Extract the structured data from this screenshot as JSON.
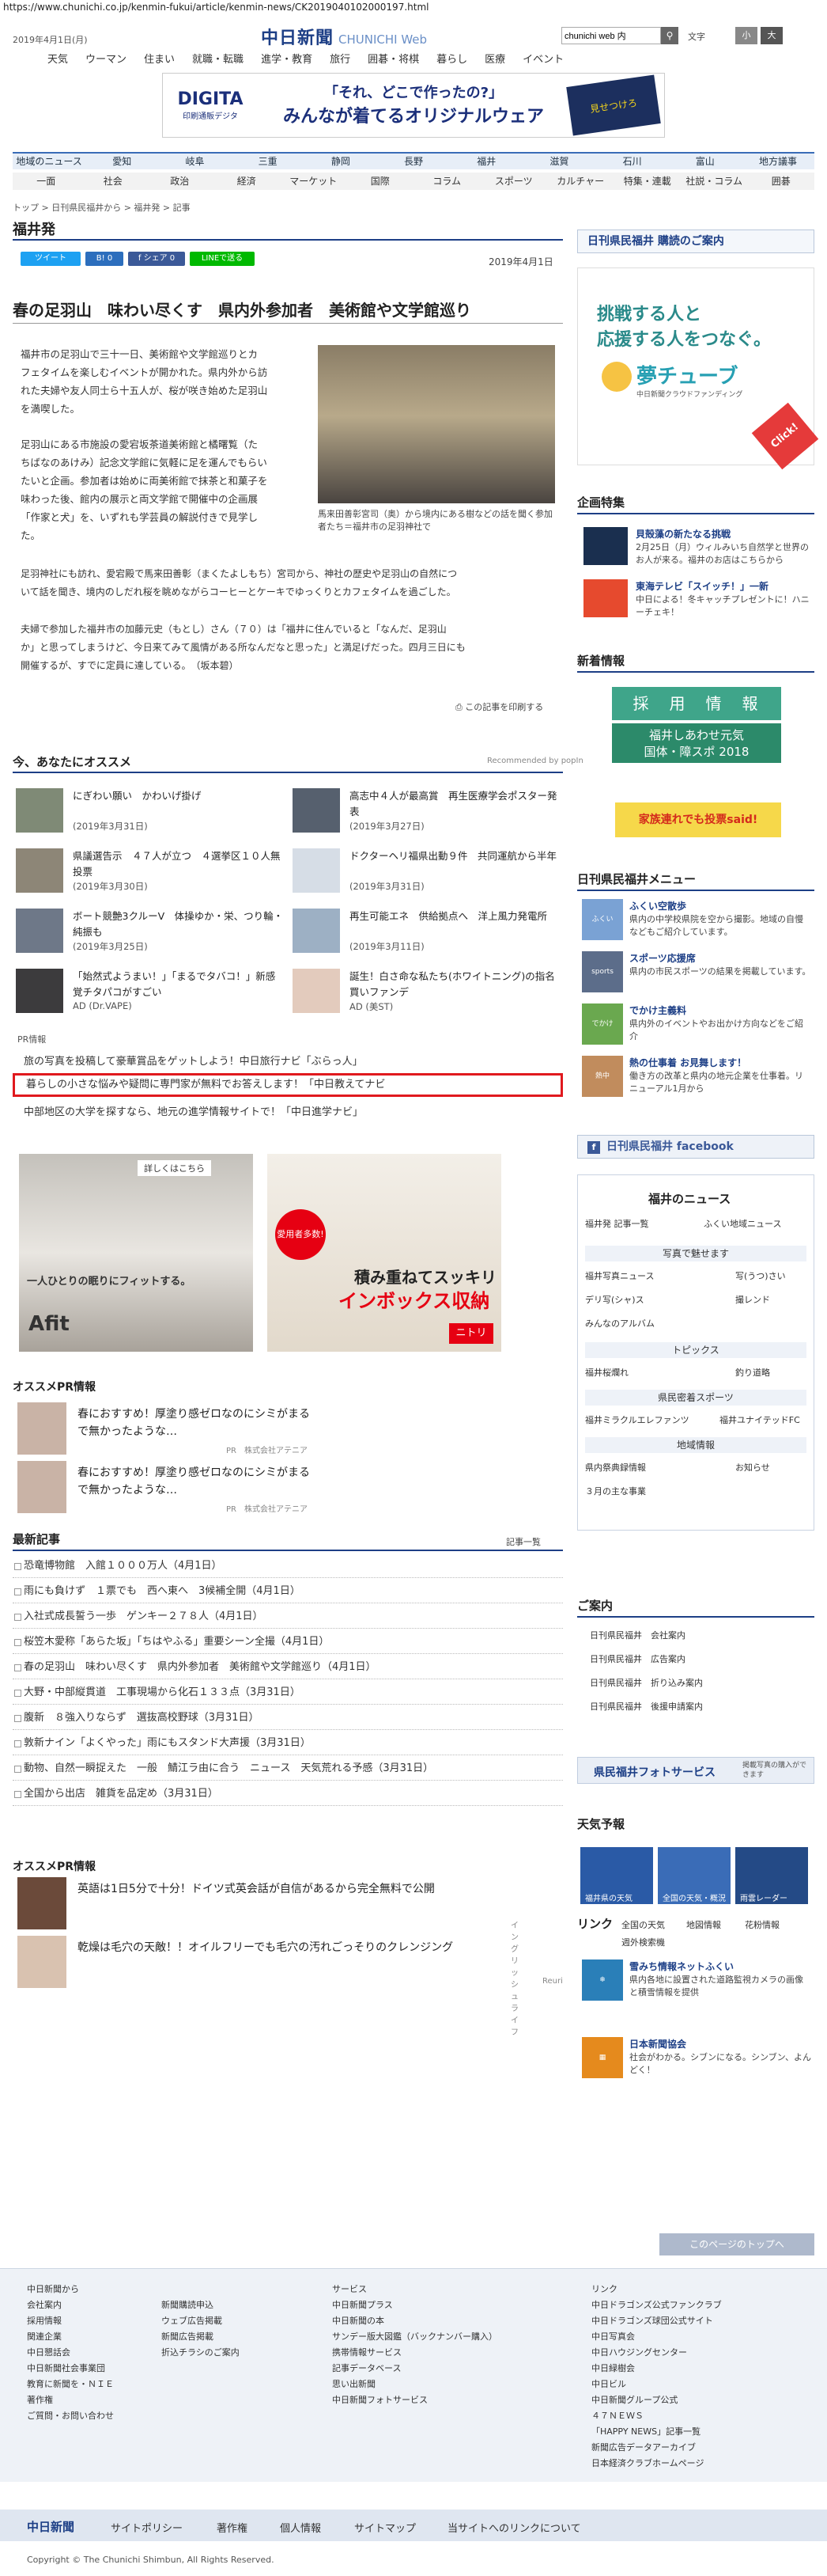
{
  "browser": {
    "url": "https://www.chunichi.co.jp/kenmin-fukui/article/kenmin-news/CK2019040102000197.html"
  },
  "header": {
    "date": "2019年4月1日(月)",
    "logo_main": "中日新聞",
    "logo_sub": "CHUNICHI Web",
    "search_value": "chunichi web 内",
    "font_label": "文字",
    "font_decrease": "小",
    "font_increase": "大",
    "nav": [
      "天気",
      "ウーマン",
      "住まい",
      "就職・転職",
      "進学・教育",
      "旅行",
      "囲碁・将棋",
      "暮らし",
      "医療",
      "イベント"
    ]
  },
  "banner": {
    "brand": "DIGITA",
    "brand_sub": "印刷通販デジタ",
    "line1": "「それ、どこで作ったの?」",
    "line2": "みんなが着てるオリジナルウェア",
    "shirt": "見せつけろ"
  },
  "region_nav": [
    "地域のニュース",
    "愛知",
    "岐阜",
    "三重",
    "静岡",
    "長野",
    "福井",
    "滋賀",
    "石川",
    "富山",
    "地方議事"
  ],
  "cat_nav": [
    "一面",
    "社会",
    "政治",
    "経済",
    "マーケット",
    "国際",
    "コラム",
    "スポーツ",
    "カルチャー",
    "特集・連載",
    "社説・コラム",
    "囲碁"
  ],
  "breadcrumb": "トップ > 日刊県民福井から > 福井発 > 記事",
  "section_title": "福井発",
  "share": {
    "tweet": "ツイート",
    "hatena": "B! 0",
    "facebook": "f シェア 0",
    "line": "LINEで送る"
  },
  "article": {
    "date": "2019年4月1日",
    "headline": "春の足羽山　味わい尽くす　県内外参加者　美術館や文学館巡り",
    "p1": [
      "福井市の足羽山で三十一日、美術館や文学館巡りとカ",
      "フェタイムを楽しむイベントが開かれた。県内外から訪",
      "れた夫婦や友人同士ら十五人が、桜が咲き始めた足羽山",
      "を満喫した。"
    ],
    "p2": [
      "足羽山にある市施設の愛宕坂茶道美術館と橘曙覧（た",
      "ちばなのあけみ）記念文学館に気軽に足を運んでもらい",
      "たいと企画。参加者は始めに両美術館で抹茶と和菓子を",
      "味わった後、館内の展示と両文学館で開催中の企画展",
      "「作家と犬」を、いずれも学芸員の解説付きで見学し",
      "た。"
    ],
    "p3": [
      "足羽神社にも訪れ、愛宕殿で馬来田善彰（まくたよしもち）宮司から、神社の歴史や足羽山の自然につ",
      "いて話を聞き、境内のしだれ桜を眺めながらコーヒーとケーキでゆっくりとカフェタイムを過ごした。"
    ],
    "p4": [
      "夫婦で参加した福井市の加藤元史（もとし）さん（７０）は「福井に住んでいると「なんだ、足羽山",
      "か」と思ってしまうけど、今日来てみて風情がある所なんだなと思った」と満足げだった。四月三日にも",
      "開催するが、すでに定員に達している。　（坂本碧）"
    ],
    "photo_caption": "馬来田善彰宮司（奥）から境内にある樹などの話を聞く参加者たち＝福井市の足羽神社で",
    "print_link": "この記事を印刷する"
  },
  "recommend": {
    "heading": "今、あなたにオススメ",
    "by": "Recommended by popIn",
    "items": [
      {
        "title": "にぎわい願い　かわいげ掛げ",
        "date": "(2019年3月31日)"
      },
      {
        "title": "高志中４人が最高賞　再生医療学会ポスター発表",
        "date": "(2019年3月27日)"
      },
      {
        "title": "県議選告示　４７人が立つ　４選挙区１０人無投票",
        "date": "(2019年3月30日)"
      },
      {
        "title": "ドクターヘリ福県出動９件　共同運航から半年",
        "date": "(2019年3月31日)"
      },
      {
        "title": "ボート競艶3クルーV　体操ゆか・栄、つり輪・純振も",
        "date": "(2019年3月25日)"
      },
      {
        "title": "再生可能エネ　供給拠点へ　洋上風力発電所",
        "date": "(2019年3月11日)"
      },
      {
        "title": "「始然式ようまい！」「まるでタバコ！」新感覚チタパコがすごい",
        "date": "AD (Dr.VAPE)"
      },
      {
        "title": "誕生！白さ命な私たち(ホワイトニング)の指名買いファンデ",
        "date": "AD (美ST)"
      }
    ]
  },
  "pr": {
    "label": "PR情報",
    "lines": [
      "旅の写真を投稿して豪華賞品をゲットしよう！中日旅行ナビ「ぶらっ人」",
      "暮らしの小さな悩みや疑問に専門家が無料でお答えします！「中日教えてナビ",
      "中部地区の大学を探すなら、地元の進学情報サイトで！「中日進学ナビ」"
    ]
  },
  "ads": {
    "left_top": "詳しくはこちら",
    "left_slogan": "一人ひとりの眠りにフィットする。",
    "left_brand": "Afit",
    "right_slogan": "積み重ねてスッキリ",
    "right_title": "インボックス収納",
    "right_brand": "ニトリ",
    "right_badge": "愛用者多数!"
  },
  "oso_pr": {
    "heading": "オススメPR情報",
    "items": [
      {
        "title": "春におすすめ！厚塗り感ゼロなのにシミがまるで無かったような…",
        "sponsor": "PR　株式会社アテニア"
      },
      {
        "title": "春におすすめ！厚塗り感ゼロなのにシミがまるで無かったような…",
        "sponsor": "PR　株式会社アテニア"
      }
    ]
  },
  "latest": {
    "heading": "最新記事",
    "more": "記事一覧",
    "items": [
      "恐竜博物館　入館１０００万人（4月1日）",
      "雨にも負けず　１票でも　西へ東へ　3候補全開（4月1日）",
      "入社式成長誓う一歩　ゲンキー２７８人（4月1日）",
      "桜笠木愛称「あらた坂」「ちはやふる」重要シーン全撮（4月1日）",
      "春の足羽山　味わい尽くす　県内外参加者　美術館や文学館巡り（4月1日）",
      "大野・中部縦貫道　工事現場から化石１３３点（3月31日）",
      "腹新　８強入りならず　選抜高校野球（3月31日）",
      "敦新ナイン「よくやった」雨にもスタンド大声援（3月31日）",
      "動物、自然一瞬捉えた　一般　鯖江ラ由に合う　ニュース　天気荒れる予感（3月31日）",
      "全国から出店　雑貨を品定め（3月31日）"
    ]
  },
  "oso_pr2": {
    "heading": "オススメPR情報",
    "items": [
      {
        "title": "英語は1日5分で十分！ドイツ式英会話が自信があるから完全無料で公開",
        "sponsor": "イングリッシュライフ"
      },
      {
        "title": "乾燥は毛穴の天敵！！オイルフリーでも毛穴の汚れごっそりのクレンジング",
        "sponsor": "Reuri"
      }
    ]
  },
  "sidebar": {
    "subscribe": "日刊県民福井 購読のご案内",
    "yume_line1": "挑戦する人と",
    "yume_line2": "応援する人をつなぐ。",
    "yume_title": "夢チューブ",
    "yume_sub": "中日新聞クラウドファンディング",
    "yume_click": "Click!",
    "kikaku_title": "企画特集",
    "kikaku": [
      {
        "title": "貝殻藻の新たなる挑戦",
        "desc": "2月25日（月）ウィルみいち自然学と世界のお人が来る。福井のお店はこちらから"
      },
      {
        "title": "東海テレビ「スイッチ！」一新",
        "desc": "中日による！冬キャッチプレゼントに！ハニーチェキ！"
      }
    ],
    "shinchaku": "新着情報",
    "recruit": "採　用　情　報",
    "shiawase_line1": "福井しあわせ元気",
    "shiawase_line2": "国体・障スポ 2018",
    "kazoku": "家族連れでも投票said!",
    "menu_title": "日刊県民福井メニュー",
    "menu": [
      {
        "icon": "ふくい",
        "title": "ふくい空散歩",
        "desc": "県内の中学校県院を空から撮影。地域の自慢などもご紹介しています。"
      },
      {
        "icon": "sports",
        "title": "スポーツ応援席",
        "desc": "県内の市民スポーツの結果を掲載しています。"
      },
      {
        "icon": "でかけ",
        "title": "でかけ主義料",
        "desc": "県内外のイベントやお出かけ方向などをご紹介"
      },
      {
        "icon": "熱中",
        "title": "熱の仕事着 お見舞します！",
        "desc": "働き方の改革と県内の地元企業を仕事着。リニューアル1月から"
      }
    ],
    "facebook": "日刊県民福井 facebook",
    "news_title": "福井のニュース",
    "news_row1": [
      "福井発 記事一覧",
      "ふくい地域ニュース"
    ],
    "photo_head": "写真で魅せます",
    "photo_links": [
      "福井写真ニュース",
      "写(うつ)さい",
      "デリ写(シャ)ス",
      "撮レンド",
      "みんなのアルバム"
    ],
    "topics_head": "トピックス",
    "topics_links": [
      "福井桜爛れ",
      "釣り道略"
    ],
    "sports_head": "県民密着スポーツ",
    "sports_links": [
      "福井ミラクルエレファンツ",
      "福井ユナイテッドFC"
    ],
    "area_head": "地域情報",
    "area_links": [
      "県内祭典録情報",
      "お知らせ",
      "３月の主な事業"
    ],
    "guide_title": "ご案内",
    "guide": [
      "日刊県民福井　会社案内",
      "日刊県民福井　広告案内",
      "日刊県民福井　折り込み案内",
      "日刊県民福井　後援申請案内"
    ],
    "photo_service": "県民福井フォトサービス",
    "photo_service_sub": "掲載写真の購入ができます",
    "weather_title": "天気予報",
    "weather_tiles": [
      "福井県の天気",
      "全国の天気・概況",
      "雨雲レーダー"
    ],
    "link_title": "リンク",
    "link_row": [
      "全国の天気",
      "地図情報",
      "花粉情報",
      "週外検索機"
    ],
    "yuki_title": "雪みち情報ネットふくい",
    "yuki_desc": "県内各地に設置された道路監視カメラの画像と積雪情報を提供",
    "kaikan_title": "日本新聞協会",
    "kaikan_desc": "社会がわかる。シブンになる。シンブン、よんどく！"
  },
  "footer": {
    "pagetop": "このページのトップへ",
    "col1": [
      "中日新聞から",
      "会社案内",
      "採用情報",
      "関連企業",
      "中日懇話会",
      "中日新聞社会事業団",
      "教育に新聞を・ＮＩＥ",
      "著作権",
      "ご質問・お問い合わせ"
    ],
    "col2": [
      "新聞購読申込",
      "ウェブ広告掲載",
      "新聞広告掲載",
      "折込チラシのご案内"
    ],
    "col3": [
      "サービス",
      "中日新聞プラス",
      "中日新聞の本",
      "サンデー版大図鑑（バックナンバー購入）",
      "携帯情報サービス",
      "記事データベース",
      "思い出新聞",
      "中日新聞フォトサービス"
    ],
    "col4": [
      "リンク",
      "中日ドラゴンズ公式ファンクラブ",
      "中日ドラゴンズ球団公式サイト",
      "中日写真会",
      "中日ハウジングセンター",
      "中日緑樹会",
      "中日ビル",
      "中日新聞グループ公式",
      "４７ＮＥＷＳ",
      "「HAPPY NEWS」記事一覧",
      "新聞広告データアーカイブ",
      "日本経済クラブホームページ"
    ],
    "bar": [
      "中日新聞",
      "サイトポリシー",
      "著作権",
      "個人情報",
      "サイトマップ",
      "当サイトへのリンクについて"
    ],
    "copyright": "Copyright © The Chunichi Shimbun, All Rights Reserved."
  }
}
